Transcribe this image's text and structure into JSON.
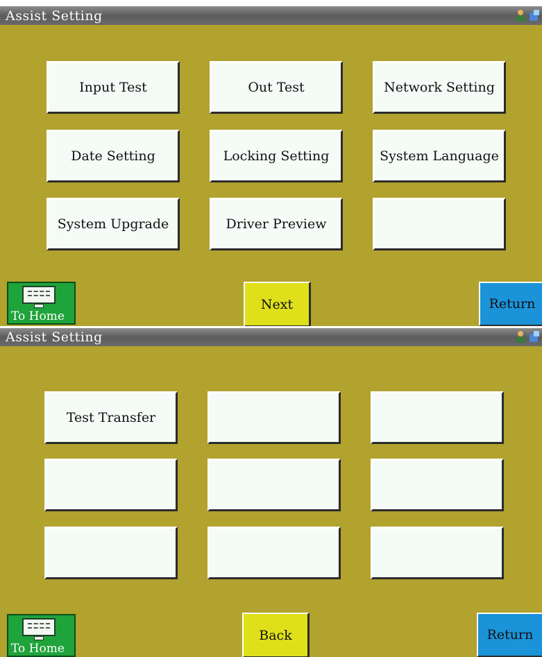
{
  "screen1": {
    "title": "Assist Setting",
    "buttons": [
      "Input Test",
      "Out Test",
      "Network Setting",
      "Date Setting",
      "Locking Setting",
      "System Language",
      "System Upgrade",
      "Driver Preview",
      ""
    ],
    "home_label": "To Home",
    "center_label": "Next",
    "return_label": "Return"
  },
  "screen2": {
    "title": "Assist Setting",
    "buttons": [
      "Test Transfer",
      "",
      "",
      "",
      "",
      "",
      "",
      "",
      ""
    ],
    "home_label": "To Home",
    "center_label": "Back",
    "return_label": "Return"
  },
  "icons": [
    "user-status-icon",
    "network-status-icon",
    "home-monitor-icon"
  ],
  "colors": {
    "background": "#b2a22e",
    "button": "#f5fbf6",
    "home": "#1fa33b",
    "next_back": "#dfe01a",
    "return": "#1b93d8",
    "titlebar": "#6a6a6a"
  }
}
